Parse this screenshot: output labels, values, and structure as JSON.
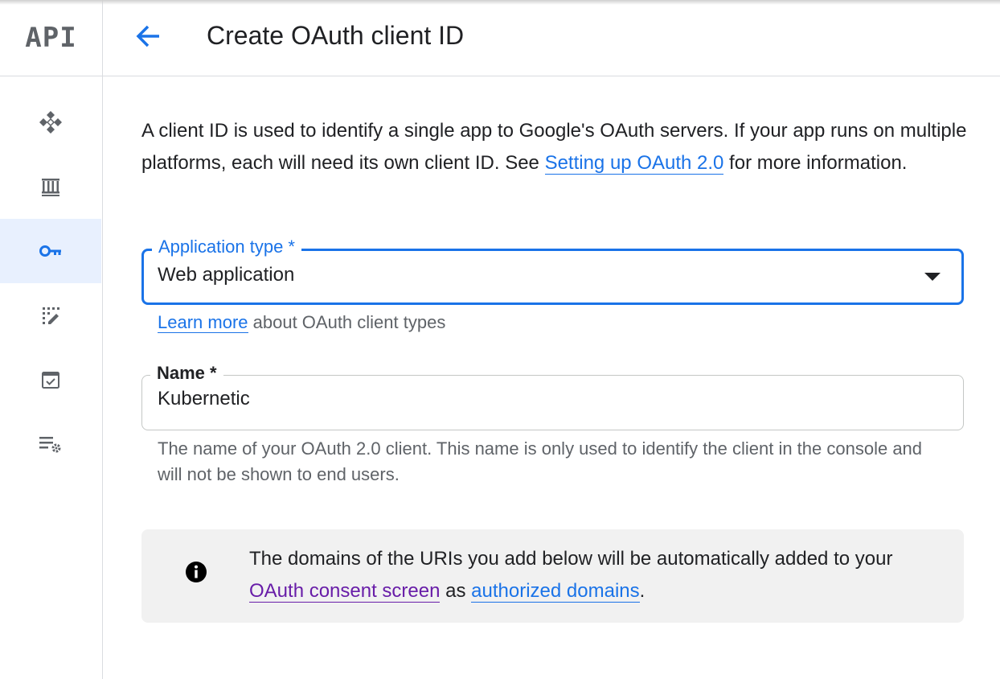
{
  "nav_rail": {
    "logo": "API",
    "items": [
      {
        "icon": "enabled-apis-icon"
      },
      {
        "icon": "library-icon"
      },
      {
        "icon": "credentials-key-icon",
        "active": true
      },
      {
        "icon": "oauth-consent-icon"
      },
      {
        "icon": "page-usage-agreements-icon"
      },
      {
        "icon": "settings-list-icon"
      }
    ]
  },
  "header": {
    "back_icon": "arrow-back-icon",
    "title": "Create OAuth client ID"
  },
  "intro": {
    "text_before_link": "A client ID is used to identify a single app to Google's OAuth servers. If your app runs on multiple platforms, each will need its own client ID. See ",
    "link_text": "Setting up OAuth 2.0",
    "text_after_link": " for more information."
  },
  "application_type": {
    "label": "Application type *",
    "value": "Web application",
    "helper_link": "Learn more",
    "helper_text": " about OAuth client types"
  },
  "name_field": {
    "label": "Name *",
    "value": "Kubernetic",
    "helper_text": "The name of your OAuth 2.0 client. This name is only used to identify the client in the console and will not be shown to end users."
  },
  "notice": {
    "icon": "info-icon",
    "text_before": "The domains of the URIs you add below will be automatically added to your ",
    "consent_link": "OAuth consent screen",
    "text_middle": " as ",
    "domains_link": "authorized domains",
    "text_after": "."
  },
  "colors": {
    "accent": "#1a73e8",
    "visited_link": "#681da8",
    "active_nav_bg": "#e8f0fe",
    "notice_bg": "#f1f1f1"
  }
}
